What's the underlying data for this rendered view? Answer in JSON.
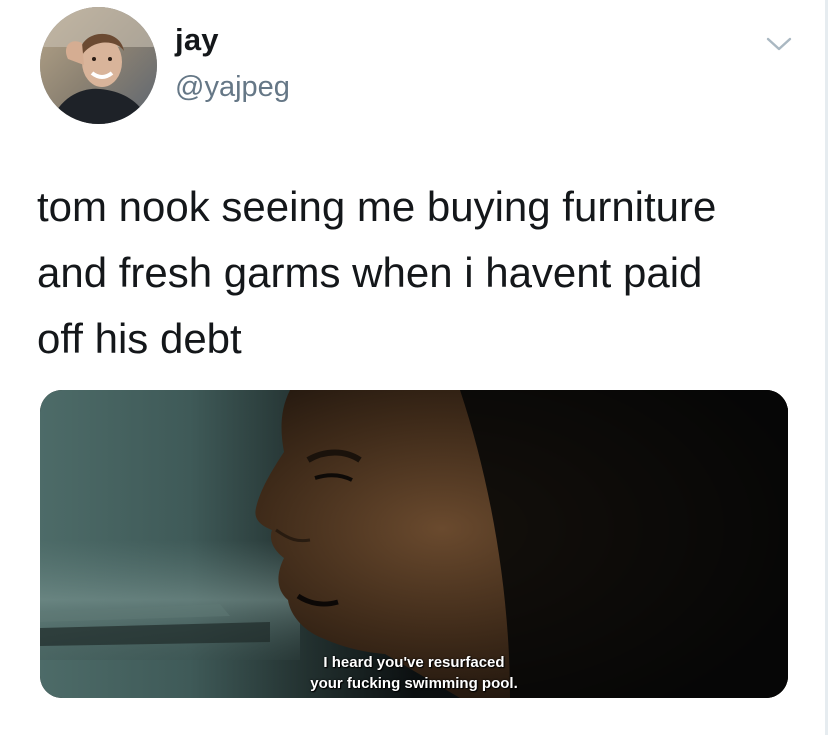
{
  "author": {
    "display_name": "jay",
    "handle": "@yajpeg",
    "avatar_icon": "user-avatar-photo"
  },
  "tweet": {
    "text_lines": [
      "tom nook seeing me buying furniture",
      "and fresh garms when i havent paid",
      "off his debt"
    ]
  },
  "media": {
    "subtitle_lines": [
      "I heard you've resurfaced",
      "your fucking swimming pool."
    ]
  },
  "icons": {
    "menu": "chevron-down-icon"
  },
  "colors": {
    "text_primary": "#14171a",
    "text_secondary": "#657786",
    "chevron": "#aab8c2",
    "background": "#ffffff"
  }
}
